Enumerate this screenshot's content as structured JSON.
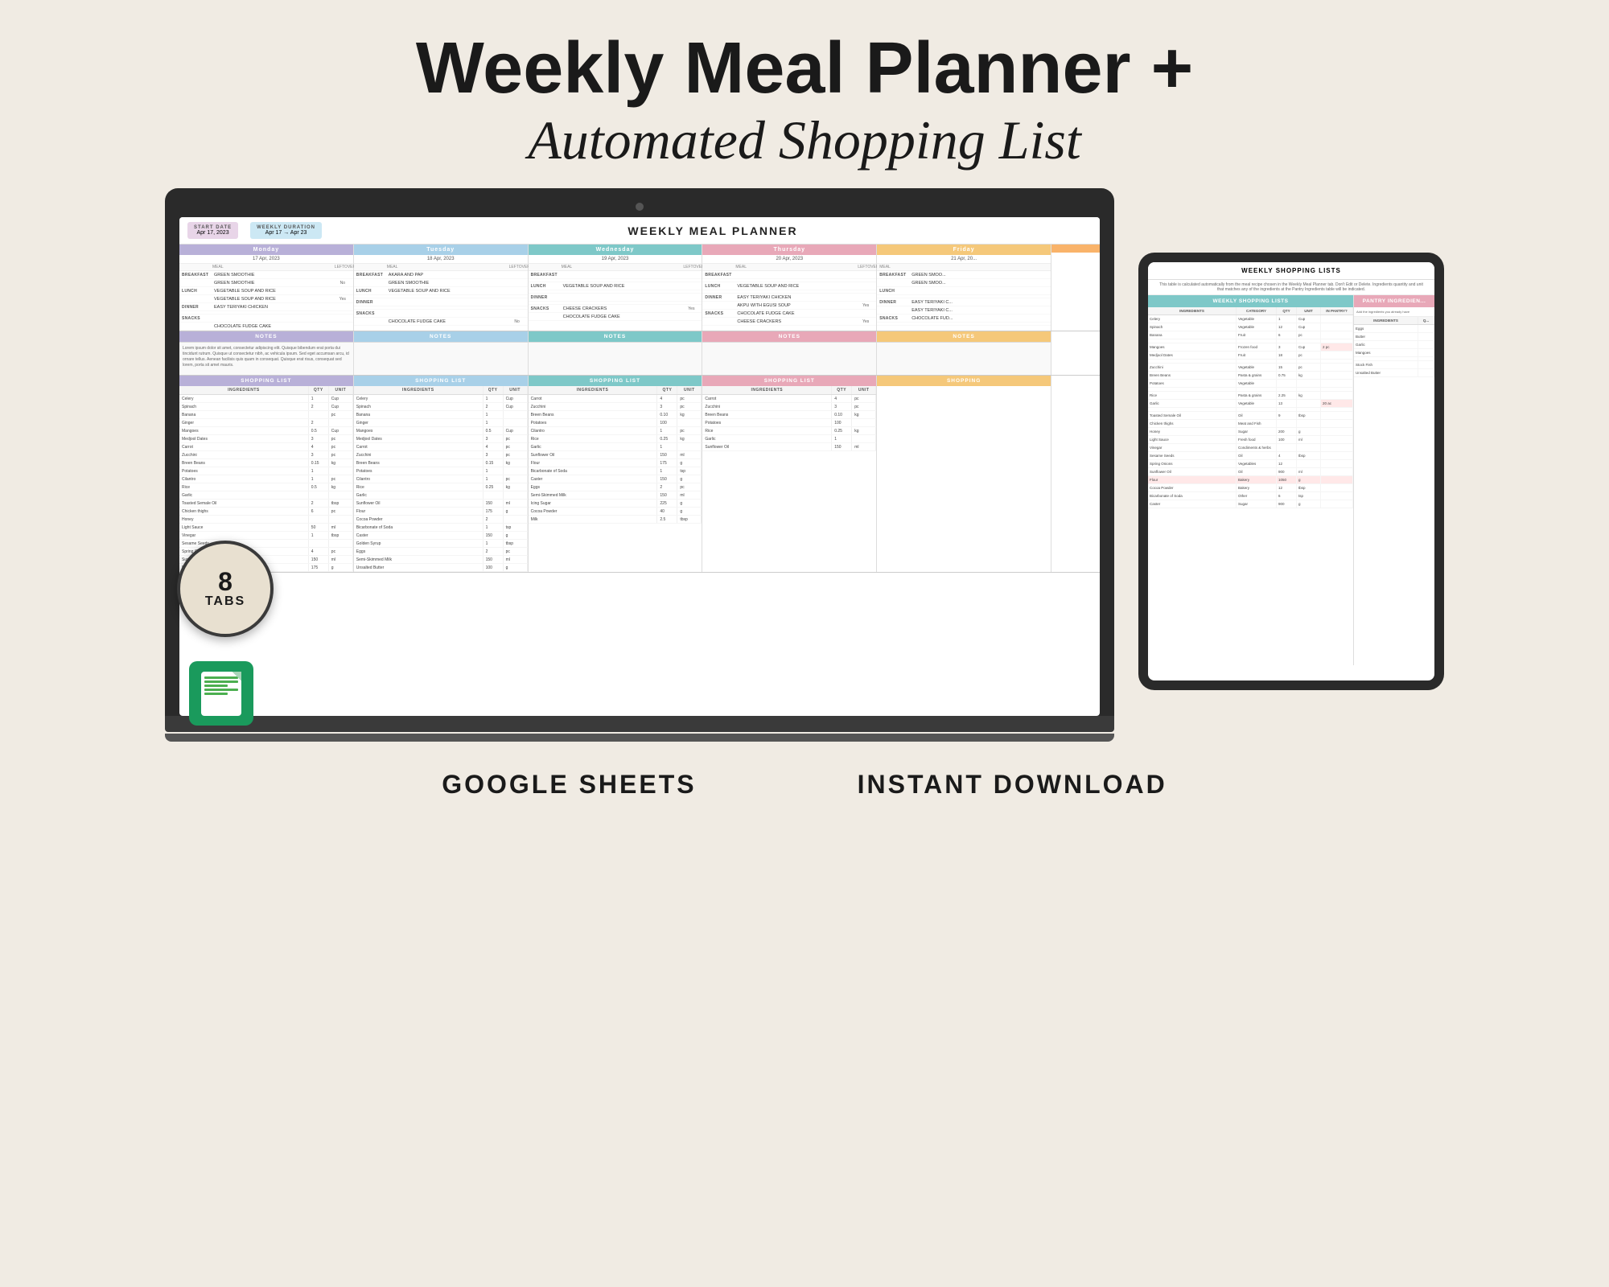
{
  "header": {
    "title": "Weekly Meal Planner +",
    "subtitle": "Automated Shopping List"
  },
  "laptop": {
    "spreadsheet": {
      "title": "WEEKLY MEAL PLANNER",
      "start_date_label": "START DATE",
      "start_date_value": "Apr 17, 2023",
      "duration_label": "WEEKLY DURATION",
      "duration_value": "Apr 17 → Apr 23",
      "days": [
        {
          "name": "Monday",
          "color": "monday",
          "date": "17 Apr, 2023",
          "meals": {
            "breakfast": [
              "GREEN SMOOTHIE",
              "GREEN SMOOTHIE"
            ],
            "lunch": [
              "VEGETABLE SOUP AND RICE",
              "VEGETABLE SOUP AND RICE"
            ],
            "dinner": [
              "EASY TERIYAKI CHICKEN"
            ],
            "snacks": [
              "CHOCOLATE FUDGE CAKE"
            ]
          },
          "leftovers": {
            "lunch": "Yes"
          },
          "notes": "Lorem ipsum dolor sit amet, consectetur adipiscing elit. Quisque bibendum erat porta dui tincidunt rutrum. Quisque ut consectetur nibh, ac vehicula ipsum. Sed eget accumsan arcu, id ornare tellus. Aenean facilisis quis quam in consequat. Quisque erat risus, consequat sed lorem, porta sit amet mauris."
        },
        {
          "name": "Tuesday",
          "color": "tuesday",
          "date": "18 Apr, 2023",
          "meals": {
            "breakfast": [
              "AKARA AND PAP",
              "GREEN SMOOTHIE"
            ],
            "lunch": [
              "VEGETABLE SOUP AND RICE"
            ],
            "dinner": [],
            "snacks": [
              "CHOCOLATE FUDGE CAKE"
            ]
          },
          "leftovers": {
            "snacks": "No"
          },
          "notes": ""
        },
        {
          "name": "Wednesday",
          "color": "wednesday",
          "date": "19 Apr, 2023",
          "meals": {
            "breakfast": [],
            "lunch": [
              "VEGETABLE SOUP AND RICE"
            ],
            "dinner": [],
            "snacks": [
              "CHEESE CRACKERS",
              "CHOCOLATE FUDGE CAKE"
            ]
          },
          "leftovers": {
            "snacks": "Yes"
          },
          "notes": ""
        },
        {
          "name": "Thursday",
          "color": "thursday",
          "date": "20 Apr, 2023",
          "meals": {
            "breakfast": [],
            "lunch": [
              "VEGETABLE SOUP AND RICE"
            ],
            "dinner": [
              "EASY TERIYAKI CHICKEN",
              "AKPU WITH EGUSI SOUP"
            ],
            "snacks": [
              "CHOCOLATE FUDGE CAKE",
              "CHEESE CRACKERS"
            ]
          },
          "leftovers": {
            "dinner": "Yes",
            "snacks": "Yes"
          },
          "notes": ""
        },
        {
          "name": "Friday",
          "color": "friday",
          "date": "21 Apr, 20...",
          "meals": {
            "breakfast": [
              "GREEN SMOO...",
              "GREEN SMOO..."
            ],
            "lunch": [],
            "dinner": [
              "EASY TERIYAKI C...",
              "EASY TERIYAKI C...",
              "CHOCOLATE FUD..."
            ],
            "snacks": []
          },
          "leftovers": {},
          "notes": ""
        }
      ],
      "shopping_items": {
        "monday": [
          [
            "Celery",
            "1",
            "Cup"
          ],
          [
            "Spinach",
            "2",
            "Cup"
          ],
          [
            "Banana",
            "",
            "pc"
          ],
          [
            "Ginger",
            "2",
            ""
          ],
          [
            "Mangoes",
            "0.5",
            "Cup"
          ],
          [
            "Medjool Dates",
            "3",
            "pc"
          ],
          [
            "Carrot",
            "4",
            "pc"
          ],
          [
            "Zucchini",
            "3",
            "pc"
          ],
          [
            "Breen Beans",
            "0.15",
            "kg"
          ],
          [
            "Potatoes",
            "1",
            ""
          ],
          [
            "Cilantro",
            "1",
            "pc"
          ],
          [
            "Rice",
            "0.5",
            "kg"
          ],
          [
            "Garlic",
            "",
            ""
          ],
          [
            "Toasted Semale Oil",
            "2",
            "tbsp"
          ],
          [
            "Chicken thighs",
            "6",
            "pc"
          ],
          [
            "Honey",
            "",
            ""
          ],
          [
            "Light Sauce",
            "50",
            "ml"
          ],
          [
            "Vinegar",
            "1",
            "tbsp"
          ],
          [
            "Sesame Seeds",
            "",
            ""
          ],
          [
            "Spring Onions",
            "4",
            "pc"
          ],
          [
            "Sunflower Oil",
            "150",
            "ml"
          ],
          [
            "Flour",
            "175",
            "g"
          ]
        ],
        "tuesday": [
          [
            "Celery",
            "1",
            "Cup"
          ],
          [
            "Spinach",
            "2",
            "Cup"
          ],
          [
            "Banana",
            "1",
            ""
          ],
          [
            "Ginger",
            "1",
            ""
          ],
          [
            "Mangoes",
            "0.5",
            "Cup"
          ],
          [
            "Medjool Dates",
            "3",
            "pc"
          ],
          [
            "Carrot",
            "4",
            "pc"
          ],
          [
            "Zucchini",
            "3",
            "pc"
          ],
          [
            "Breen Beans",
            "0.15",
            "kg"
          ],
          [
            "Potatoes",
            "1",
            ""
          ],
          [
            "Cilantro",
            "1",
            "pc"
          ],
          [
            "Rice",
            "0.25",
            "kg"
          ],
          [
            "Garlic",
            "",
            ""
          ],
          [
            "Sunflower Oil",
            "150",
            "ml"
          ],
          [
            "Flour",
            "175",
            "g"
          ],
          [
            "Cocoa Powder",
            "2",
            ""
          ],
          [
            "Bicarbonate of Soda",
            "1",
            "tsp"
          ],
          [
            "Caster",
            "150",
            "g"
          ],
          [
            "Golden Syrup",
            "1",
            "tbsp"
          ],
          [
            "Eggs",
            "2",
            "pc"
          ],
          [
            "Semi-Skimmed Milk",
            "150",
            "ml"
          ],
          [
            "Unsalted Butter",
            "100",
            "g"
          ]
        ],
        "wednesday": [
          [
            "Carrot",
            "4",
            "pc"
          ],
          [
            "Zucchini",
            "3",
            "pc"
          ],
          [
            "Breen Beans",
            "0.10",
            "kg"
          ],
          [
            "Potatoes",
            "100",
            ""
          ],
          [
            "Cilantro",
            "1",
            "pc"
          ],
          [
            "Rice",
            "0.25",
            "kg"
          ],
          [
            "Garlic",
            "1",
            ""
          ],
          [
            "Sunflower Oil",
            "150",
            "ml"
          ],
          [
            "Flour",
            "175",
            "g"
          ],
          [
            "Bicarbonate of Soda",
            "1",
            "tsp"
          ],
          [
            "Caster",
            "150",
            "g"
          ],
          [
            "Eggs",
            "2",
            "pc"
          ],
          [
            "Semi-Skimmed Milk",
            "150",
            "ml"
          ],
          [
            "Icing Sugar",
            "225",
            "g"
          ],
          [
            "Cocoa Powder",
            "40",
            "g"
          ],
          [
            "Milk",
            "2.5",
            "tbsp"
          ]
        ]
      }
    }
  },
  "tablet": {
    "title": "WEEKLY SHOPPING LISTS",
    "subtitle": "This table is calculated automatically from the meal recipe chosen in the Weekly Meal Planner tab. Don't Edit or Delete. Ingredients quantity and unit that matches any of the ingredients at the Pantry Ingredients table will be indicated.",
    "pantry_title": "PANTRY INGREDIEN...",
    "pantry_subtitle": "Add the ingredients you already have",
    "col_headers": [
      "INGREDIENTS",
      "CATEGORY",
      "QTY",
      "UNIT",
      "IN PANTRY?"
    ],
    "pantry_col_headers": [
      "INGREDIENTS",
      "Q..."
    ],
    "rows": [
      [
        "Celery",
        "Vegetable",
        "1",
        "Cup",
        ""
      ],
      [
        "Spinach",
        "Vegetable",
        "12",
        "Cup",
        ""
      ],
      [
        "Banana",
        "Fruit",
        "6",
        "pc",
        ""
      ],
      [
        "",
        "",
        "",
        "",
        ""
      ],
      [
        "Mangoes",
        "Frozen food",
        "3",
        "Cup",
        "2 pc"
      ],
      [
        "Medjool Dates",
        "Fruit",
        "18",
        "pc",
        ""
      ],
      [
        "",
        "",
        "",
        "",
        ""
      ],
      [
        "Zucchini",
        "Vegetable",
        "15",
        "pc",
        ""
      ],
      [
        "Breen Beans",
        "Pasta & grains",
        "0.75",
        "kg",
        ""
      ],
      [
        "Potatoes",
        "Vegetable",
        "",
        "",
        ""
      ],
      [
        "",
        "",
        "",
        "",
        ""
      ],
      [
        "Rice",
        "Pasta & grains",
        "2.25",
        "kg",
        ""
      ],
      [
        "Garlic",
        "Vegetable",
        "13",
        "",
        "20 ac"
      ],
      [
        "",
        "",
        "",
        "",
        ""
      ],
      [
        "Toasted Semale Oil",
        "Oil",
        "9",
        "tbsp",
        ""
      ],
      [
        "Chicken thighs",
        "Meat and Fish",
        "",
        "",
        ""
      ],
      [
        "Honey",
        "Sugar",
        "200",
        "g",
        ""
      ],
      [
        "Light Sauce",
        "Fresh food",
        "100",
        "ml",
        ""
      ],
      [
        "Vinegar",
        "Condiments & herbs",
        "",
        "",
        ""
      ],
      [
        "Sesame Seeds",
        "Oil",
        "4",
        "tbsp",
        ""
      ],
      [
        "Spring Onions",
        "Vegetables",
        "12",
        "",
        ""
      ],
      [
        "Sunflower Oil",
        "Oil",
        "900",
        "ml",
        ""
      ],
      [
        "Flour",
        "Bakery",
        "1050",
        "g",
        ""
      ],
      [
        "Cocoa Powder",
        "Bakery",
        "12",
        "tbsp",
        ""
      ],
      [
        "Bicarbonate of Soda",
        "Other",
        "6",
        "tsp",
        ""
      ],
      [
        "Caster",
        "Sugar",
        "900",
        "g",
        ""
      ]
    ],
    "pantry_rows": [
      [
        "Eggs",
        ""
      ],
      [
        "Butter",
        ""
      ],
      [
        "Garlic",
        ""
      ],
      [
        "Mangoes",
        ""
      ],
      [
        "",
        ""
      ],
      [
        "Stock Fish",
        ""
      ],
      [
        "Unsalted Butter",
        ""
      ]
    ]
  },
  "footer": {
    "google_sheets": "GOOGLE SHEETS",
    "instant_download": "INSTANT DOWNLOAD"
  },
  "badge": {
    "number": "8",
    "text": "TABS"
  },
  "colors": {
    "monday": "#b8b0d8",
    "tuesday": "#a8d0e8",
    "wednesday": "#7ec8c8",
    "thursday": "#e8a8b8",
    "friday": "#f5c87a",
    "background": "#f0ebe3"
  }
}
